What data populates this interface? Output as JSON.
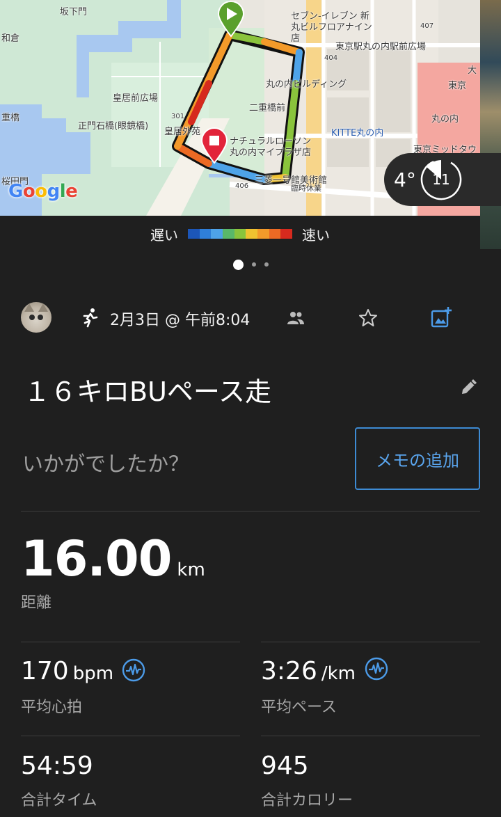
{
  "map": {
    "labels": {
      "sakashitamon": "坂下門",
      "wakura": "和倉",
      "kokyomae_hiroba": "皇居前広場",
      "seimon_ishibashi": "正門石橋(眼鏡橋)",
      "nijubashi_left": "重橋",
      "kokyo_gaien": "皇居外苑",
      "nijubashimae": "二重橋前",
      "seven_eleven": "セブン-イレブン 新丸ビルフロアナイン店",
      "tokyo_station_plaza": "東京駅丸の内駅前広場",
      "tokyo_station": "東京",
      "marunouchi_building": "丸の内ビルディング",
      "kitte": "KITTE丸の内",
      "natural_lawson": "ナチュラルローソン 丸の内マイプラザ店",
      "mitsubishi_museum": "三菱一号館美術館",
      "temporary_closed": "臨時休業",
      "tokyo_midtown": "東京ミッドタウ",
      "marunouchi": "丸の内",
      "daimaru": "大",
      "sakuradamon": "桜田門",
      "route_404": "404",
      "route_406": "406",
      "route_407": "407",
      "route_301": "301"
    },
    "google_logo": [
      "G",
      "o",
      "o",
      "g",
      "l",
      "e"
    ]
  },
  "weather": {
    "temperature": "4°",
    "wind": "11"
  },
  "legend": {
    "slow": "遅い",
    "fast": "速い",
    "colors": [
      "#1c56b8",
      "#2f7fd8",
      "#4ea3e8",
      "#59b86a",
      "#8ac43c",
      "#f0c230",
      "#f39a2a",
      "#ec6a24",
      "#d62a1e"
    ]
  },
  "pager": {
    "count": 3,
    "active": 0
  },
  "activity": {
    "date": "2月3日 @ 午前8:04",
    "title": "１６キロBUペース走",
    "prompt": "いかがでしたか？",
    "memo_button": "メモの追加"
  },
  "stats": {
    "distance": {
      "value": "16.00",
      "unit": "km",
      "label": "距離"
    },
    "avg_hr": {
      "value": "170",
      "unit": "bpm",
      "label": "平均心拍"
    },
    "avg_pace": {
      "value": "3:26",
      "unit": "/km",
      "label": "平均ペース"
    },
    "total_time": {
      "value": "54:59",
      "label": "合計タイム"
    },
    "calories": {
      "value": "945",
      "label": "合計カロリー"
    }
  },
  "colors": {
    "background": "#1f1f1f",
    "accent_blue": "#3d8bd4",
    "start_marker": "#5aa02c",
    "end_marker": "#e2243a"
  }
}
